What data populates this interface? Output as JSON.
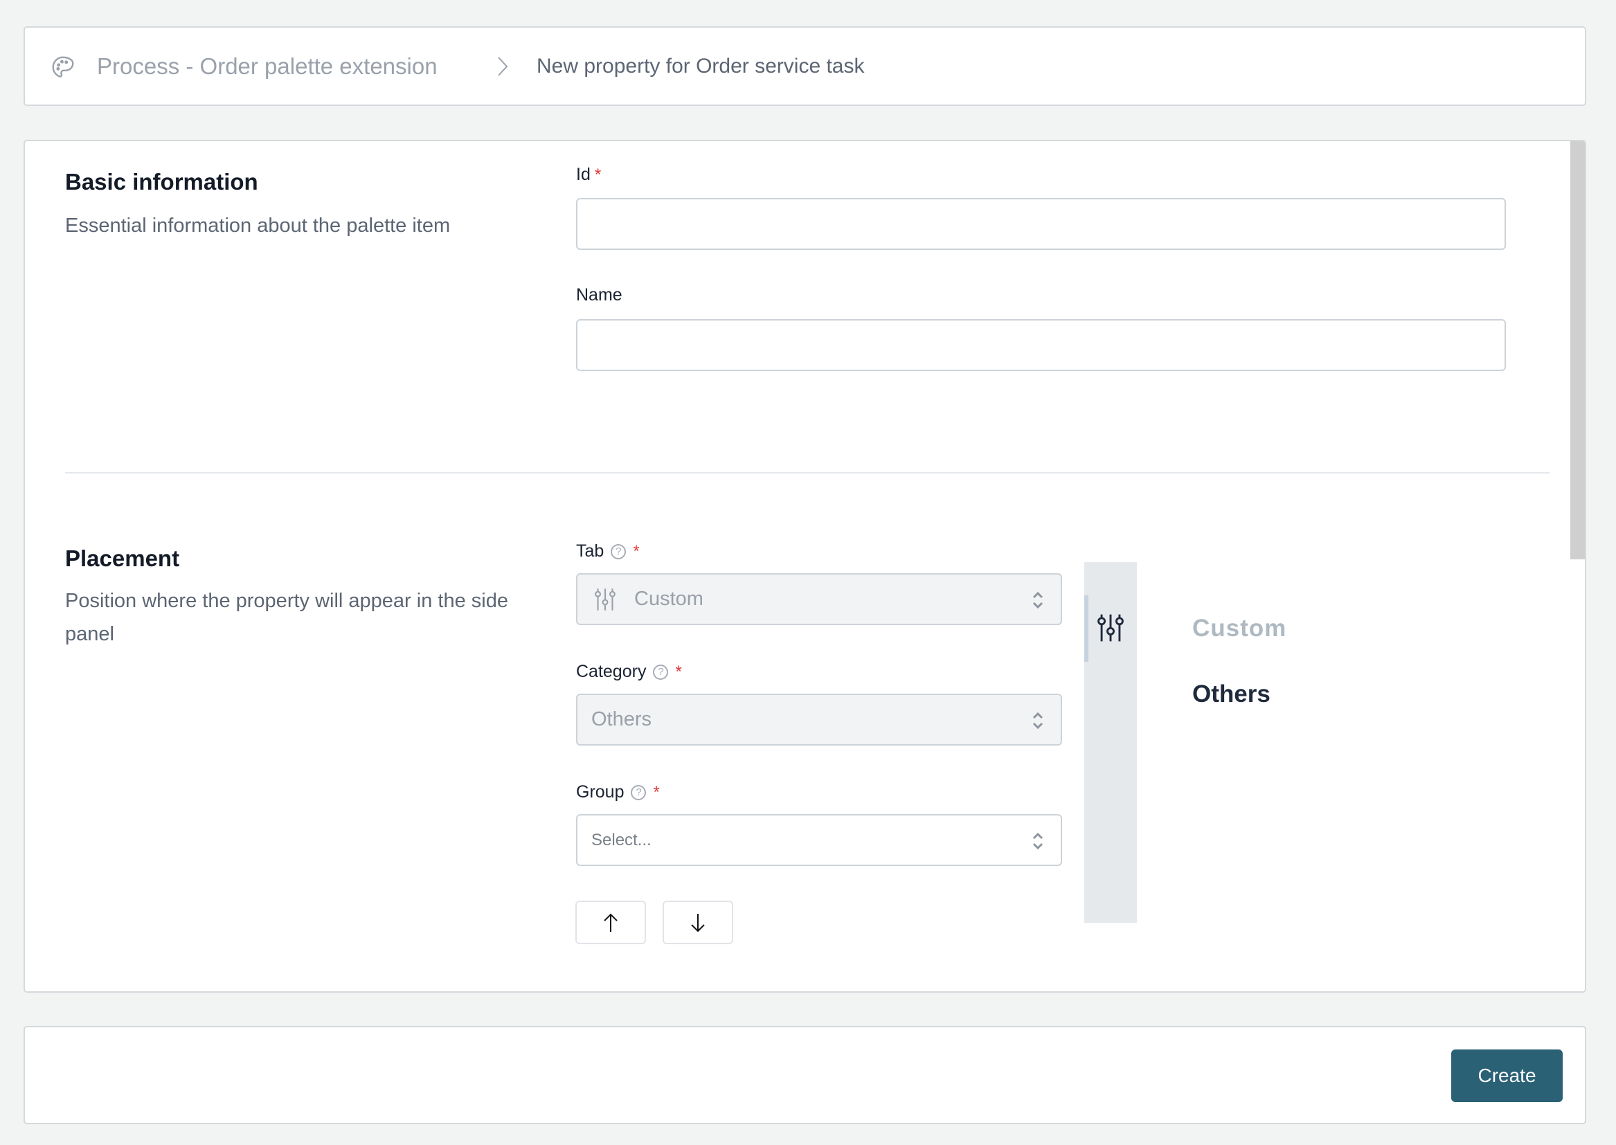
{
  "breadcrumb": {
    "icon": "palette-icon",
    "parent": "Process - Order palette extension",
    "separator_icon": "chevron-right-icon",
    "separator": "›",
    "current": "New property for Order service task"
  },
  "basic_information": {
    "title": "Basic information",
    "description": "Essential information about the palette item",
    "fields": {
      "id": {
        "label": "Id",
        "required": true,
        "required_mark": "*",
        "value": "",
        "placeholder": ""
      },
      "name": {
        "label": "Name",
        "required": false,
        "value": "",
        "placeholder": ""
      }
    }
  },
  "placement": {
    "title": "Placement",
    "description": "Position where the property will appear in the side panel",
    "fields": {
      "tab": {
        "label": "Tab",
        "help": "?",
        "required_mark": "*",
        "icon": "tune-icon",
        "value": "Custom",
        "disabled": true
      },
      "category": {
        "label": "Category",
        "help": "?",
        "required_mark": "*",
        "value": "Others",
        "disabled": true
      },
      "group": {
        "label": "Group",
        "help": "?",
        "required_mark": "*",
        "value": "",
        "placeholder": "Select..."
      }
    },
    "move_up_label": "↑",
    "move_down_label": "↓",
    "preview": {
      "tab_icon": "tune-icon",
      "tab_name": "Custom",
      "category_name": "Others"
    }
  },
  "footer": {
    "create_label": "Create"
  },
  "colors": {
    "primary": "#2a6175",
    "required": "#e0393b",
    "background": "#f2f4f4"
  }
}
